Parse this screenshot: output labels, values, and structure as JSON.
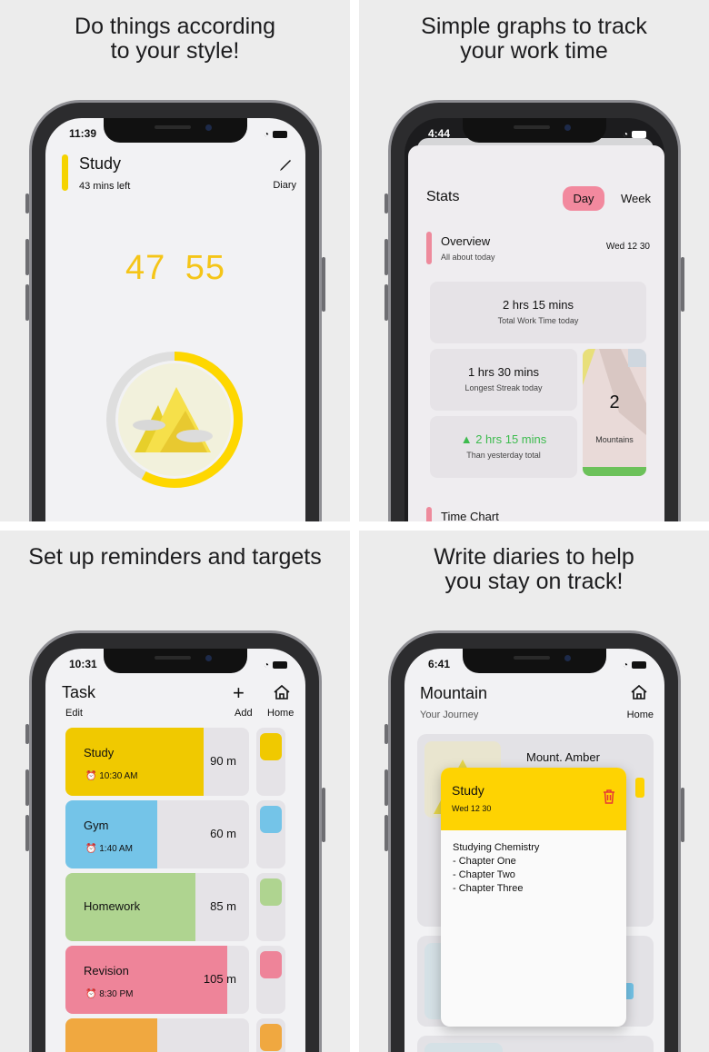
{
  "panel1": {
    "caption": "Do things according\nto your style!",
    "status_time": "11:39",
    "title": "Study",
    "subtitle": "43 mins left",
    "diary_label": "Diary",
    "timer_minutes": "47",
    "timer_seconds": "55",
    "progress": 0.58,
    "accent": "#f5d300"
  },
  "panel2": {
    "caption": "Simple graphs to track\nyour work time",
    "status_time": "4:44",
    "title": "Stats",
    "tab_day": "Day",
    "tab_week": "Week",
    "overview_title": "Overview",
    "overview_sub": "All about today",
    "date": "Wed 12 30",
    "total_value": "2 hrs 15 mins",
    "total_label": "Total Work Time today",
    "streak_value": "1 hrs 30 mins",
    "streak_label": "Longest Streak today",
    "compare_value": "2 hrs 15 mins",
    "compare_label": "Than yesterday total",
    "mountains_count": "2",
    "mountains_label": "Mountains",
    "time_chart_title": "Time Chart"
  },
  "panel3": {
    "caption": "Set up reminders and targets",
    "status_time": "10:31",
    "title": "Task",
    "edit_label": "Edit",
    "add_label": "Add",
    "home_label": "Home",
    "tasks": [
      {
        "name": "Study",
        "alarm": "10:30 AM",
        "minutes": "90 m",
        "color": "#f0c900",
        "fill": 0.75
      },
      {
        "name": "Gym",
        "alarm": "1:40 AM",
        "minutes": "60 m",
        "color": "#74c4e8",
        "fill": 0.5
      },
      {
        "name": "Homework",
        "alarm": "",
        "minutes": "85 m",
        "color": "#afd490",
        "fill": 0.71
      },
      {
        "name": "Revision",
        "alarm": "8:30 PM",
        "minutes": "105 m",
        "color": "#ee8499",
        "fill": 0.88
      },
      {
        "name": "",
        "alarm": "",
        "minutes": "",
        "color": "#f0a840",
        "fill": 0.5
      }
    ]
  },
  "panel4": {
    "caption": "Write diaries to help\nyou stay on track!",
    "status_time": "6:41",
    "title": "Mountain",
    "subtitle": "Your Journey",
    "home_label": "Home",
    "mount_name": "Mount. Amber",
    "modal_title": "Study",
    "modal_date": "Wed 12 30",
    "modal_body": "Studying Chemistry\n- Chapter One\n- Chapter Two\n- Chapter Three"
  }
}
